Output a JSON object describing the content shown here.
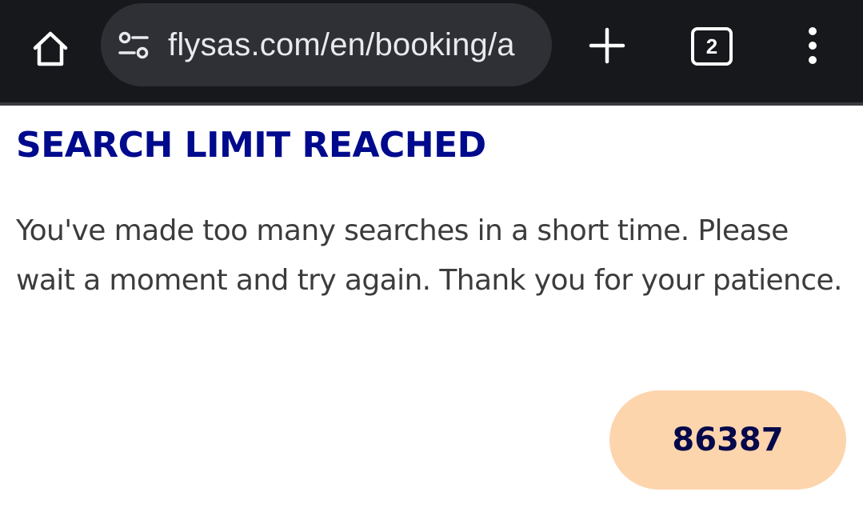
{
  "browser": {
    "url": "flysas.com/en/booking/a",
    "tab_count": "2",
    "icons": {
      "home": "home-icon",
      "site_settings": "tune-icon",
      "new_tab": "plus-icon",
      "tabs": "tab-switcher-icon",
      "menu": "more-vert-icon"
    }
  },
  "page": {
    "heading": "SEARCH LIMIT REACHED",
    "message": "You've made too many searches in a short time. Please wait a moment and try again. Thank you for your patience.",
    "code": "86387"
  },
  "colors": {
    "toolbar_bg": "#17181c",
    "urlbar_bg": "#2f3035",
    "heading": "#000a8c",
    "badge_bg": "#fdd5ad",
    "badge_text": "#05084a"
  }
}
